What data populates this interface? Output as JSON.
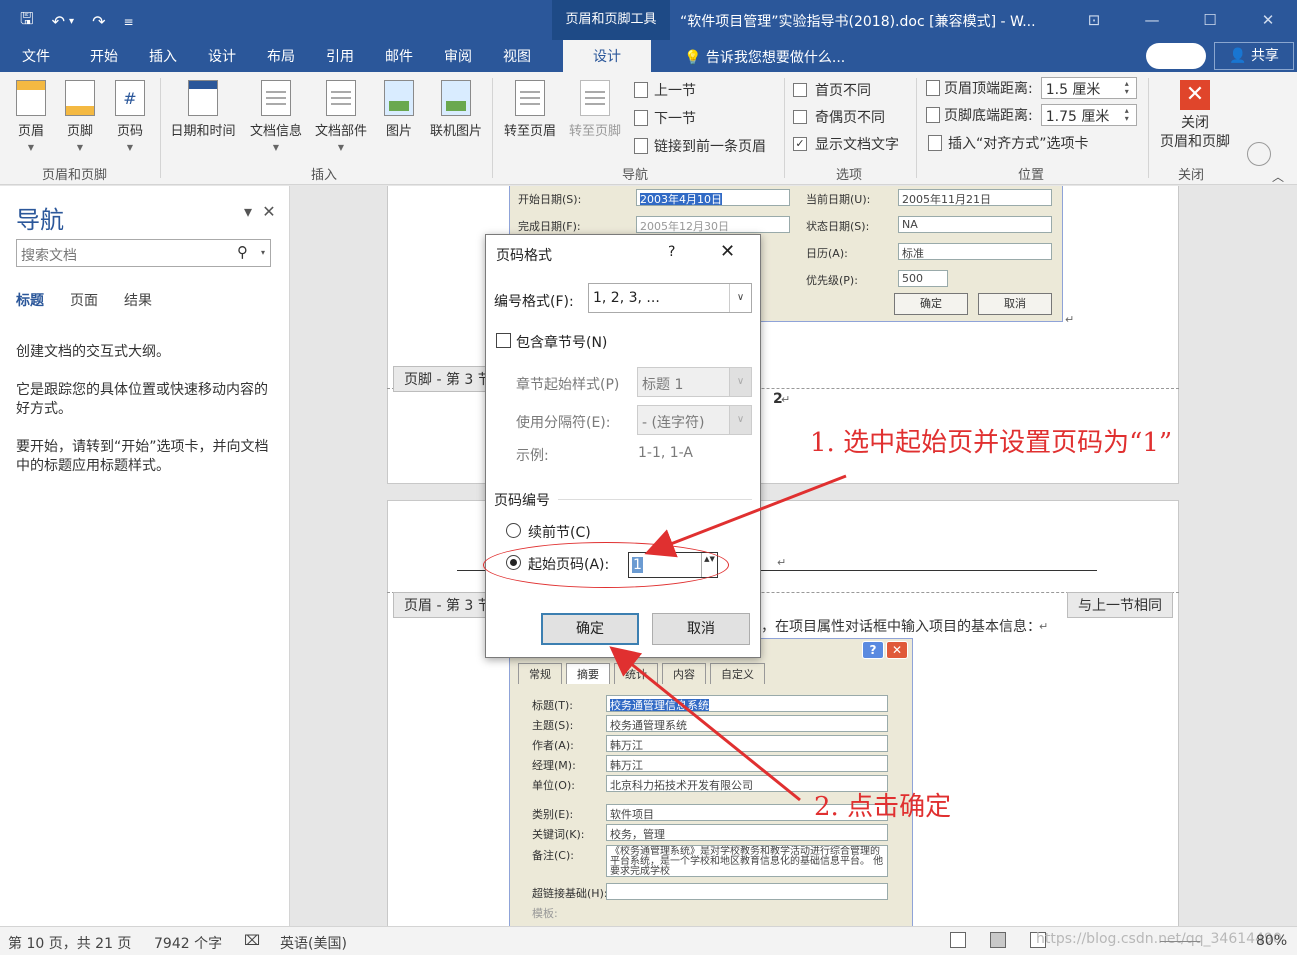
{
  "titlebar": {
    "qat": {
      "save": "🖫",
      "undo": "↶",
      "undo_dd": "▾",
      "redo": "↷",
      "customize": "≡"
    },
    "context_tool": "页眉和页脚工具",
    "document_title": "“软件项目管理”实验指导书(2018).doc [兼容模式] - W...",
    "window_buttons": {
      "ribbon_options": "⊡",
      "minimize": "—",
      "maximize": "☐",
      "close": "✕"
    }
  },
  "tabs": {
    "items": [
      "文件",
      "开始",
      "插入",
      "设计",
      "布局",
      "引用",
      "邮件",
      "审阅",
      "视图"
    ],
    "active": "设计",
    "tell_me_icon": "💡",
    "tell_me": "告诉我您想要做什么...",
    "share_icon": "👤",
    "share": "共享"
  },
  "ribbon": {
    "header_footer_group": {
      "label": "页眉和页脚",
      "buttons": [
        "页眉",
        "页脚",
        "页码"
      ]
    },
    "insert_group": {
      "label": "插入",
      "buttons": [
        "日期和时间",
        "文档信息",
        "文档部件",
        "图片",
        "联机图片"
      ]
    },
    "navigation_group": {
      "label": "导航",
      "goto_header": "转至页眉",
      "goto_footer": "转至页脚",
      "prev_section": "上一节",
      "next_section": "下一节",
      "link_previous": "链接到前一条页眉"
    },
    "options_group": {
      "label": "选项",
      "different_first": {
        "label": "首页不同",
        "checked": false
      },
      "different_odd_even": {
        "label": "奇偶页不同",
        "checked": false
      },
      "show_doc_text": {
        "label": "显示文档文字",
        "checked": true
      },
      "check_mark": "✓"
    },
    "position_group": {
      "label": "位置",
      "header_top_label": "页眉顶端距离:",
      "header_top_value": "1.5 厘米",
      "footer_bottom_label": "页脚底端距离:",
      "footer_bottom_value": "1.75 厘米",
      "insert_align_tab": "插入“对齐方式”选项卡"
    },
    "close_group": {
      "label": "关闭",
      "button": "关闭\n页眉和页脚",
      "icon": "✕"
    },
    "collapse_icon": "︿"
  },
  "nav_pane": {
    "title": "导航",
    "collapse_icon": "▾",
    "close_icon": "✕",
    "search_placeholder": "搜索文档",
    "search_icon": "⚲",
    "search_dd": "▾",
    "tabs": [
      "标题",
      "页面",
      "结果"
    ],
    "active_tab": "标题",
    "paragraphs": [
      "创建文档的交互式大纲。",
      "它是跟踪您的具体位置或快速移动内容的好方式。",
      "要开始，请转到“开始”选项卡，并向文档中的标题应用标题样式。"
    ]
  },
  "document": {
    "footer_tag": "页脚 - 第 3 节 -",
    "header_tag": "页眉 - 第 3 节 -",
    "same_as_previous": "与上一节相同",
    "page_number": "2",
    "body_text": "，在项目属性对话框中输入项目的基本信息：",
    "para_mark": "↵",
    "embed_top": {
      "start_date_label": "开始日期(S):",
      "start_date": "2003年4月10日",
      "finish_date_label": "完成日期(F):",
      "finish_date": "2005年12月30日",
      "current_date_label": "当前日期(U):",
      "current_date": "2005年11月21日",
      "status_date_label": "状态日期(S):",
      "status_date": "NA",
      "calendar_label": "日历(A):",
      "calendar": "标准",
      "priority_label": "优先级(P):",
      "priority": "500",
      "ok": "确定",
      "cancel": "取消"
    },
    "embed_bottom": {
      "tabs": [
        "常规",
        "摘要",
        "统计",
        "内容",
        "自定义"
      ],
      "help": "?",
      "close": "✕",
      "rows": [
        {
          "label": "标题(T):",
          "value": "校务通管理信息系统"
        },
        {
          "label": "主题(S):",
          "value": "校务通管理系统"
        },
        {
          "label": "作者(A):",
          "value": "韩万江"
        },
        {
          "label": "经理(M):",
          "value": "韩万江"
        },
        {
          "label": "单位(O):",
          "value": "北京科力拓技术开发有限公司"
        },
        {
          "label": "类别(E):",
          "value": "软件项目"
        },
        {
          "label": "关键词(K):",
          "value": "校务，管理"
        },
        {
          "label": "备注(C):",
          "value": "《校务通管理系统》是对学校教务和教学活动进行综合管理的平台系统，是一个学校和地区教育信息化的基础信息平台。 他要求完成学校"
        }
      ],
      "hyperlink_label": "超链接基础(H):",
      "template_label": "模板:"
    }
  },
  "dialog": {
    "title": "页码格式",
    "help": "?",
    "close": "✕",
    "number_format_label": "编号格式(F):",
    "number_format_value": "1, 2, 3, ...",
    "include_chapter_label": "包含章节号(N)",
    "include_chapter_checked": false,
    "chapter_style_label": "章节起始样式(P)",
    "chapter_style_value": "标题 1",
    "separator_label": "使用分隔符(E):",
    "separator_value": "-  (连字符)",
    "example_label": "示例:",
    "example_value": "1-1, 1-A",
    "page_numbering_label": "页码编号",
    "continue_label": "续前节(C)",
    "start_at_label": "起始页码(A):",
    "start_at_value": "1",
    "start_at_selected": true,
    "ok": "确定",
    "cancel": "取消",
    "combo_arrow": "∨",
    "spin_arrows": "▲▼"
  },
  "annotations": {
    "step1": "1. 选中起始页并设置页码为“1”",
    "step2": "2. 点击确定",
    "color": "#e03030"
  },
  "statusbar": {
    "page": "第 10 页，共 21 页",
    "words": "7942 个字",
    "proofing_icon": "⌧",
    "language": "英语(美国)",
    "watermark": "https://blog.csdn.net/qq_34614490",
    "zoom": "80%"
  },
  "colors": {
    "accent": "#2b579a",
    "ribbon": "#f3f3f3",
    "close_red": "#e0452b"
  }
}
